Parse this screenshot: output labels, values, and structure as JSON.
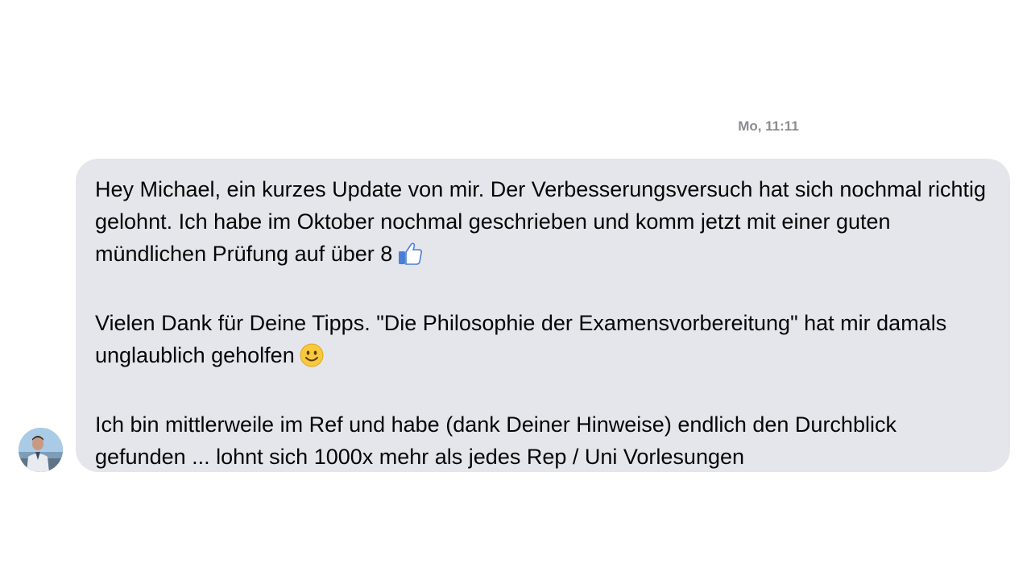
{
  "chat": {
    "timestamp": "Mo, 11:11",
    "message": {
      "paragraph_1": "Hey Michael, ein kurzes Update von mir. Der Verbesserungsversuch hat sich nochmal richtig gelohnt. Ich habe im Oktober nochmal geschrieben und komm jetzt mit einer guten mündlichen Prüfung auf über 8",
      "paragraph_1_emoji": "thumbs-up-icon",
      "paragraph_2": "Vielen Dank für Deine Tipps. \"Die Philosophie der Examensvorbereitung\" hat mir damals unglaublich geholfen",
      "paragraph_2_emoji": "smiley-icon",
      "paragraph_3": "Ich bin mittlerweile im Ref und habe (dank Deiner Hinweise) endlich den Durchblick gefunden ... lohnt sich 1000x mehr als jedes Rep / Uni Vorlesungen"
    },
    "colors": {
      "bubble_background": "#e4e6eb",
      "timestamp": "#8a8d91",
      "text": "#050505"
    }
  }
}
